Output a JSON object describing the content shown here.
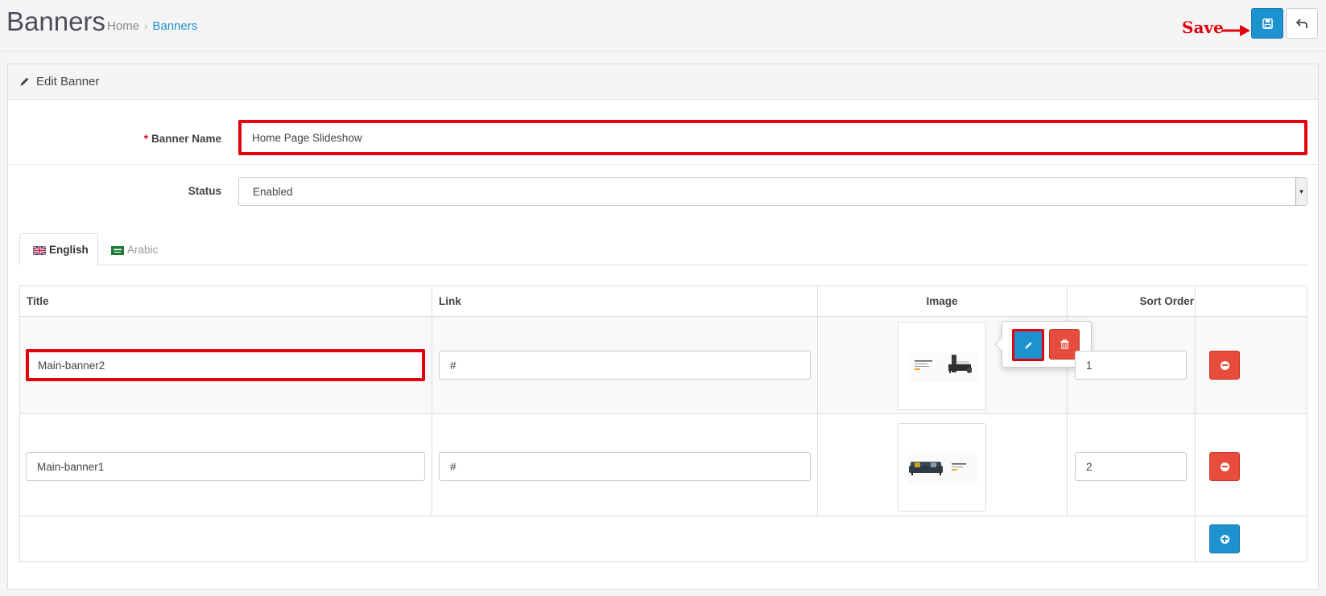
{
  "header": {
    "title": "Banners",
    "breadcrumb": {
      "home": "Home",
      "separator": "›",
      "current": "Banners"
    },
    "annotation_label": "Save",
    "save_icon": "save-icon",
    "back_icon": "reply-icon"
  },
  "panel": {
    "heading": "Edit Banner",
    "heading_icon": "pencil-icon"
  },
  "form": {
    "banner_name_required": "*",
    "banner_name_label": "Banner Name",
    "banner_name_value": "Home Page Slideshow",
    "status_label": "Status",
    "status_value": "Enabled"
  },
  "tabs": [
    {
      "label": "English",
      "active": true,
      "flag": "uk-flag-icon"
    },
    {
      "label": "Arabic",
      "active": false,
      "flag": "sa-flag-icon"
    }
  ],
  "table": {
    "headers": {
      "title": "Title",
      "link": "Link",
      "image": "Image",
      "sort_order": "Sort Order"
    },
    "rows": [
      {
        "title": "Main-banner2",
        "link": "#",
        "image": "bedroom-furniture-banner",
        "sort_order": "1"
      },
      {
        "title": "Main-banner1",
        "link": "#",
        "image": "sofa-banner",
        "sort_order": "2"
      }
    ]
  },
  "colors": {
    "primary": "#1e91cf",
    "danger": "#e74c3c",
    "highlight": "#e3000f",
    "banner_accent": "#f5a623"
  }
}
